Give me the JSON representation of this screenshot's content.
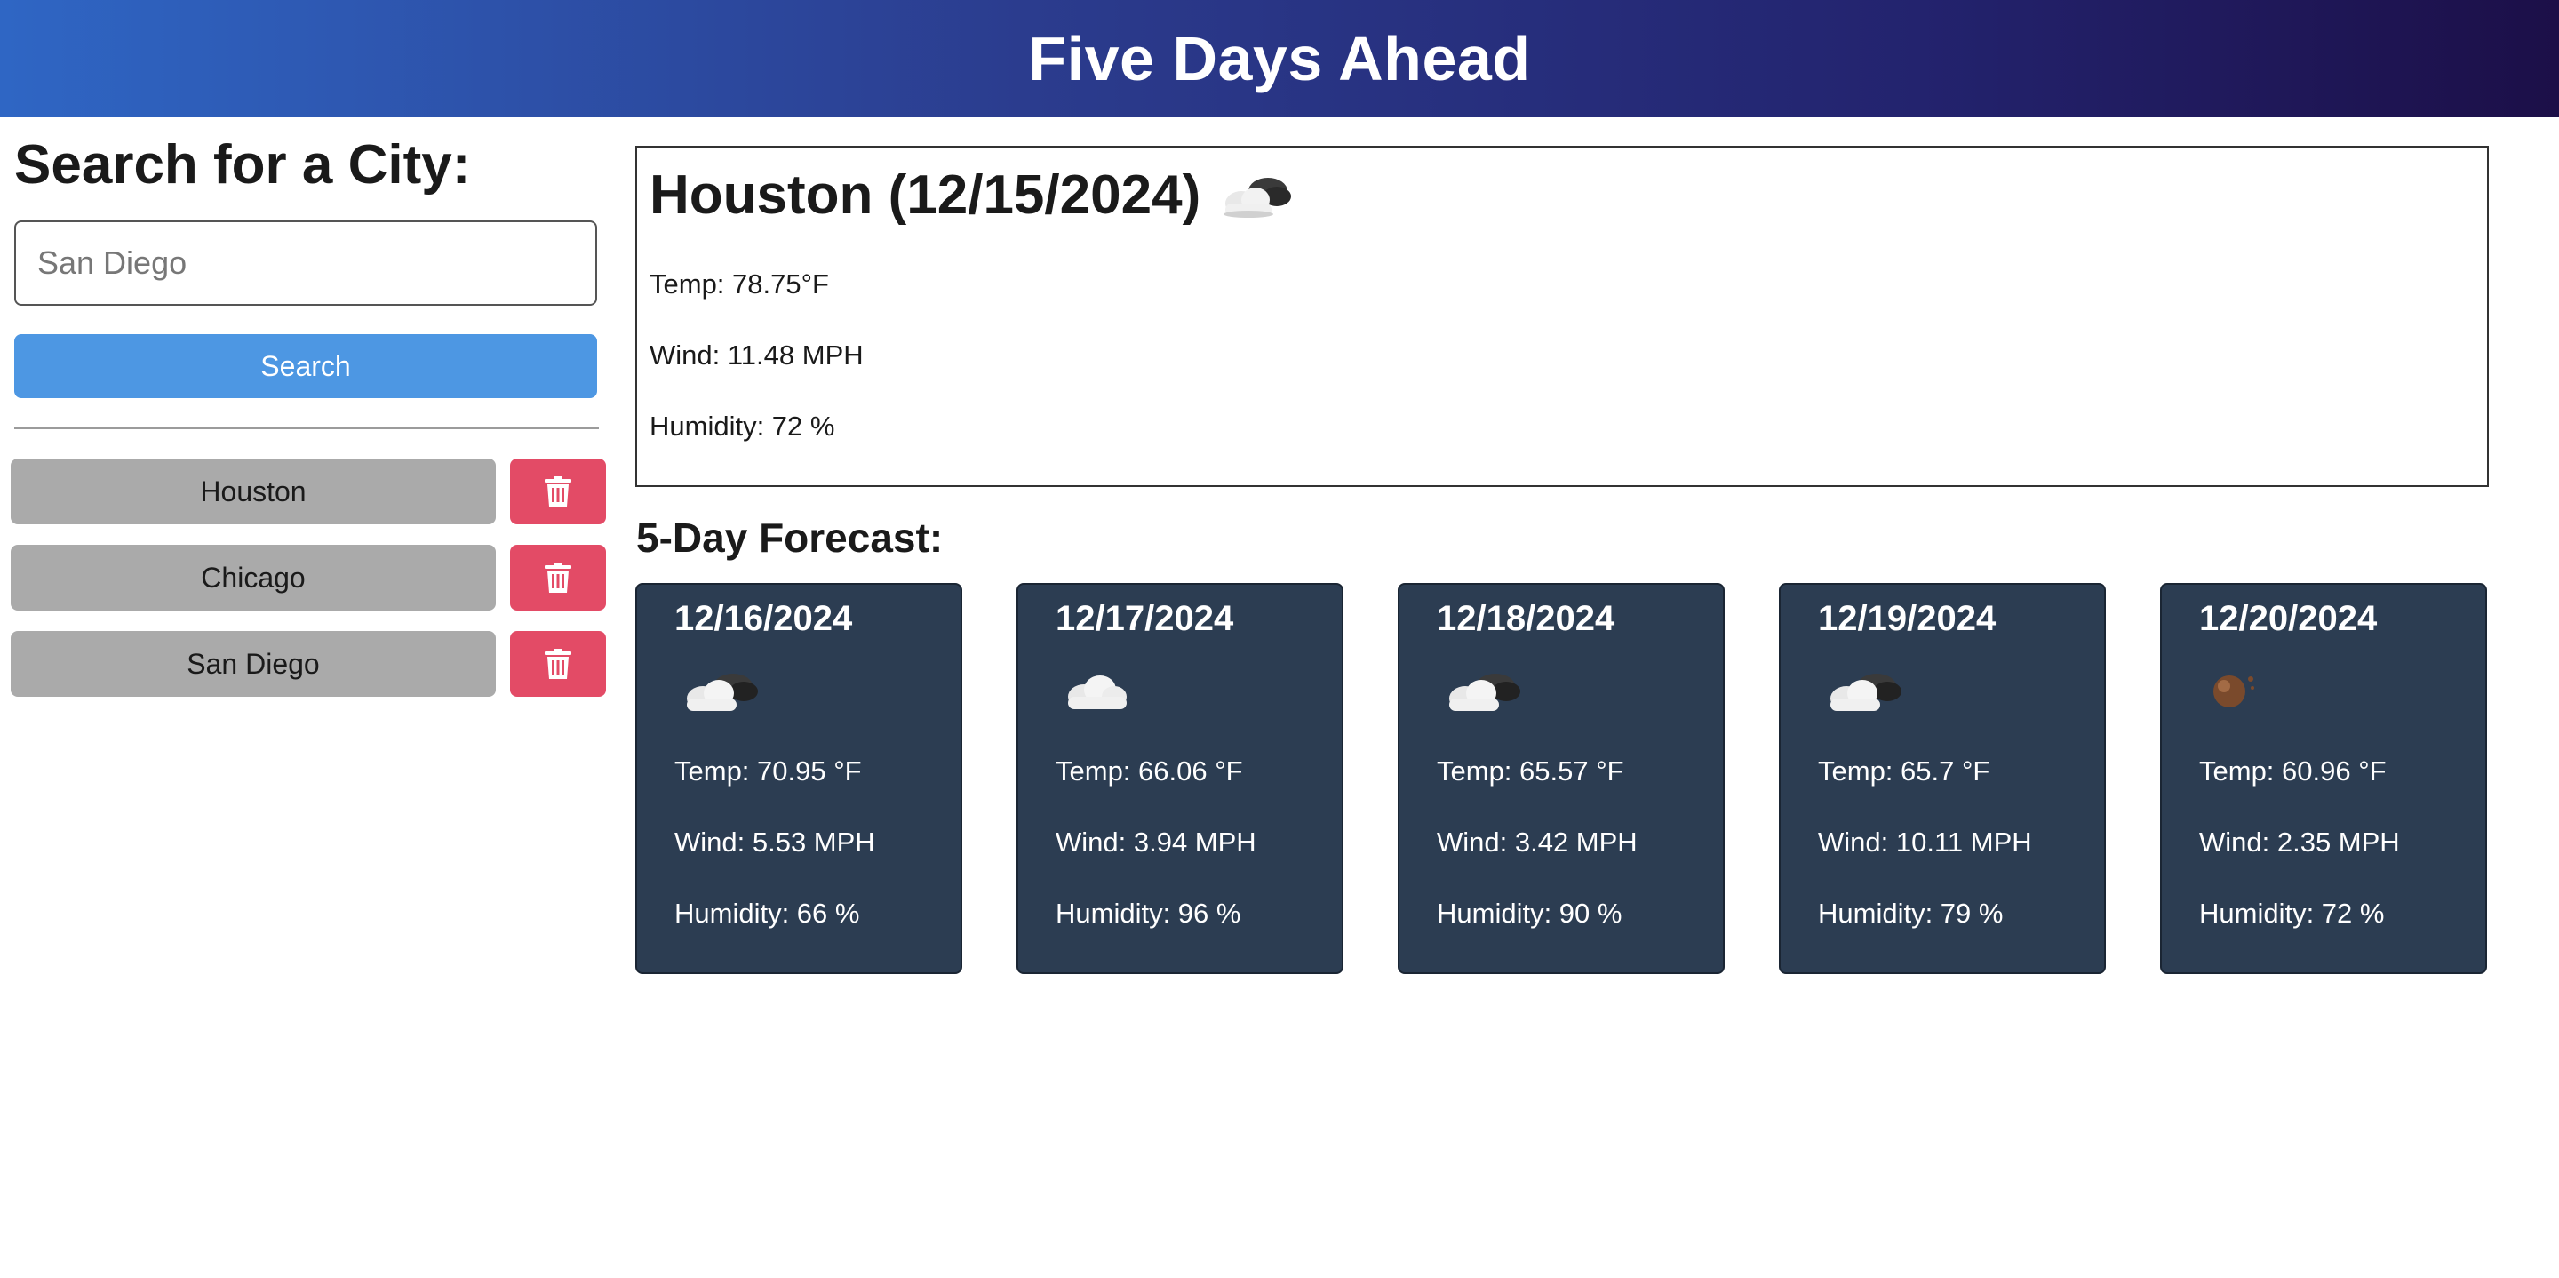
{
  "header": {
    "title": "Five Days Ahead"
  },
  "sidebar": {
    "heading": "Search for a City:",
    "search_placeholder": "San Diego",
    "search_button": "Search",
    "history": [
      {
        "city": "Houston"
      },
      {
        "city": "Chicago"
      },
      {
        "city": "San Diego"
      }
    ]
  },
  "current": {
    "heading": "Houston (12/15/2024)",
    "icon": "cloud-sun-icon",
    "temp": "Temp: 78.75°F",
    "wind": "Wind: 11.48 MPH",
    "humidity": "Humidity: 72 %"
  },
  "forecast": {
    "heading": "5-Day Forecast:",
    "days": [
      {
        "date": "12/16/2024",
        "icon": "cloud-sun-icon",
        "temp": "Temp: 70.95 °F",
        "wind": "Wind: 5.53 MPH",
        "humidity": "Humidity: 66 %"
      },
      {
        "date": "12/17/2024",
        "icon": "cloud-icon",
        "temp": "Temp: 66.06 °F",
        "wind": "Wind: 3.94 MPH",
        "humidity": "Humidity: 96 %"
      },
      {
        "date": "12/18/2024",
        "icon": "cloud-sun-icon",
        "temp": "Temp: 65.57 °F",
        "wind": "Wind: 3.42 MPH",
        "humidity": "Humidity: 90 %"
      },
      {
        "date": "12/19/2024",
        "icon": "cloud-sun-icon",
        "temp": "Temp: 65.7 °F",
        "wind": "Wind: 10.11 MPH",
        "humidity": "Humidity: 79 %"
      },
      {
        "date": "12/20/2024",
        "icon": "clear-sky-icon",
        "temp": "Temp: 60.96 °F",
        "wind": "Wind: 2.35 MPH",
        "humidity": "Humidity: 72 %"
      }
    ]
  },
  "colors": {
    "search_button": "#4d97e3",
    "history_button": "#aaaaaa",
    "delete_button": "#e34b66",
    "forecast_card": "#2c3d52"
  }
}
